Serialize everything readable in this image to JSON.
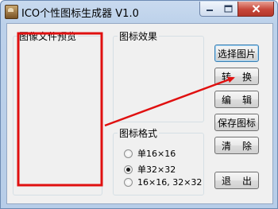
{
  "window": {
    "title": "ICO个性图标生成器 V1.0",
    "icon": "app-icon"
  },
  "groups": {
    "preview": "图像文件预览",
    "effect": "图标效果",
    "format": "图标格式"
  },
  "format_options": [
    {
      "label": "单16×16",
      "checked": false
    },
    {
      "label": "单32×32",
      "checked": true
    },
    {
      "label": "16×16, 32×32",
      "checked": false
    }
  ],
  "buttons": {
    "select_image": "选择图片",
    "convert_left": "转",
    "convert_right": "换",
    "edit_left": "编",
    "edit_right": "辑",
    "save_icon": "保存图标",
    "clear_left": "清",
    "clear_right": "除",
    "exit_left": "退",
    "exit_right": "出"
  },
  "annotation": {
    "highlight_color": "#e01010",
    "arrow_color": "#e01010"
  }
}
